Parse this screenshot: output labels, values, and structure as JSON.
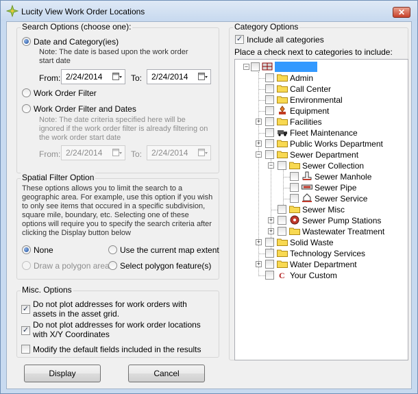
{
  "window": {
    "title": "Lucity View Work Order Locations",
    "close_glyph": "✕",
    "accent": "#3399ff"
  },
  "search": {
    "legend": "Search Options (choose one):",
    "opt_date_category": "Date and Category(ies)",
    "note_date": "Note:  The date is based upon the work order start date",
    "from_label": "From:",
    "to_label": "To:",
    "from_value": "2/24/2014",
    "to_value": "2/24/2014",
    "opt_wo_filter": "Work Order Filter",
    "opt_wo_filter_dates": "Work Order Filter and Dates",
    "note_filter": "Note:  The date criteria specified here will be ignored if the work order filter is already filtering on the work order start date",
    "from_label2": "From:",
    "to_label2": "To:",
    "from_value2": "2/24/2014",
    "to_value2": "2/24/2014"
  },
  "spatial": {
    "legend": "Spatial Filter Option",
    "description": "These options allows you to limit the search to a geographic area.  For example, use this option if you wish to only see items that occured in a specific subdivision, square mile, boundary, etc.  Selecting one of these options will require you to specify the search criteria after clicking the Display button below",
    "opt_none": "None",
    "opt_current_extent": "Use the current map extent",
    "opt_draw_polygon": "Draw a polygon area",
    "opt_select_polygon": "Select polygon feature(s)"
  },
  "misc": {
    "legend": "Misc. Options",
    "opt_assets": "Do not plot addresses for work orders with assets in the asset grid.",
    "opt_xy": "Do not plot addresses for work order locations with X/Y Coordinates",
    "opt_modify": "Modify the default fields included in the results"
  },
  "buttons": {
    "display": "Display",
    "cancel": "Cancel"
  },
  "category": {
    "legend": "Category Options",
    "include_all": "Include all categories",
    "instruction": "Place a check next to categories to include:",
    "items": [
      {
        "label": "Admin"
      },
      {
        "label": "Call Center"
      },
      {
        "label": "Environmental"
      },
      {
        "label": "Equipment"
      },
      {
        "label": "Facilities"
      },
      {
        "label": "Fleet Maintenance"
      },
      {
        "label": "Public Works Department"
      },
      {
        "label": "Sewer Department"
      },
      {
        "label": "Sewer Collection"
      },
      {
        "label": "Sewer Manhole"
      },
      {
        "label": "Sewer Pipe"
      },
      {
        "label": "Sewer Service"
      },
      {
        "label": "Sewer Misc"
      },
      {
        "label": "Sewer Pump Stations"
      },
      {
        "label": "Wastewater Treatment"
      },
      {
        "label": "Solid Waste"
      },
      {
        "label": "Technology Services"
      },
      {
        "label": "Water Department"
      },
      {
        "label": "Your Custom"
      }
    ]
  },
  "glyphs": {
    "check": "✓",
    "plus": "+",
    "minus": "−",
    "custom_c": "C"
  }
}
